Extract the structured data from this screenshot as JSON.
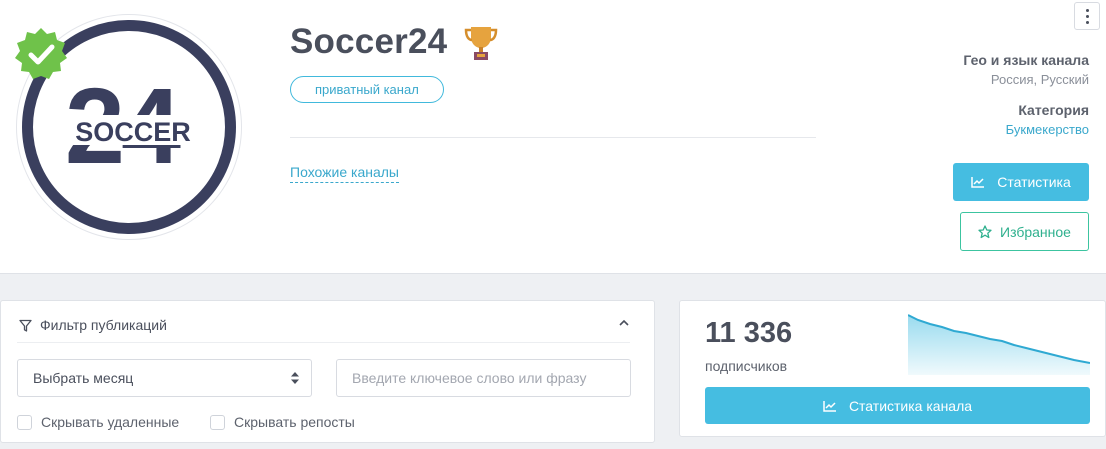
{
  "channel": {
    "title": "Soccer24",
    "logo_text": "SOCCER",
    "logo_number": "24",
    "private_badge": "приватный канал",
    "similar_link": "Похожие каналы",
    "verified_icon": "verified-badge-icon",
    "trophy_icon": "trophy-icon"
  },
  "info": {
    "geo_label": "Гео и язык канала",
    "geo_value": "Россия, Русский",
    "category_label": "Категория",
    "category_value": "Букмекерство"
  },
  "actions": {
    "stats_label": "Статистика",
    "favorite_label": "Избранное"
  },
  "filter": {
    "title": "Фильтр публикаций",
    "month_select": "Выбрать месяц",
    "keyword_placeholder": "Введите ключевое слово или фразу",
    "hide_deleted": "Скрывать удаленные",
    "hide_reposts": "Скрывать репосты"
  },
  "stats": {
    "subscribers": "11 336",
    "subscribers_label": "подписчиков",
    "channel_stats_button": "Статистика канала"
  },
  "colors": {
    "accent": "#45bde1",
    "favorite": "#3cc4a0",
    "logo": "#3a3f5e",
    "verified": "#6fc24a"
  }
}
